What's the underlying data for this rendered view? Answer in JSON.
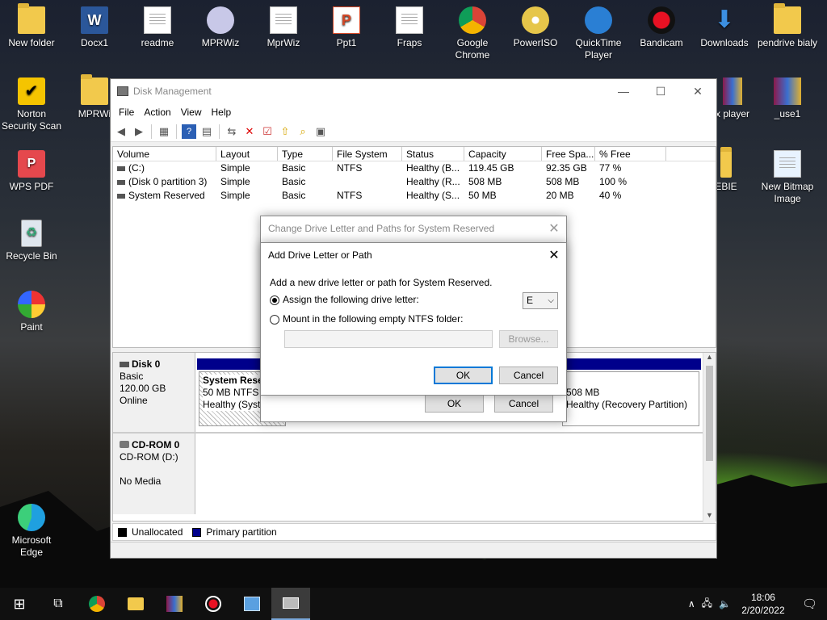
{
  "desktop": {
    "icons": [
      {
        "label": "New folder"
      },
      {
        "label": "Docx1"
      },
      {
        "label": "readme"
      },
      {
        "label": "MPRWiz"
      },
      {
        "label": "MprWiz"
      },
      {
        "label": "Ppt1"
      },
      {
        "label": "Fraps"
      },
      {
        "label": "Google Chrome"
      },
      {
        "label": "PowerISO"
      },
      {
        "label": "QuickTime Player"
      },
      {
        "label": "Bandicam"
      },
      {
        "label": "Downloads"
      },
      {
        "label": "pendrive bialy"
      },
      {
        "label": "Norton Security Scan"
      },
      {
        "label": "MPRWi"
      },
      {
        "label": "x player"
      },
      {
        "label": "_use1"
      },
      {
        "label": "WPS PDF"
      },
      {
        "label": "EBIE"
      },
      {
        "label": "New Bitmap Image"
      },
      {
        "label": "Recycle Bin"
      },
      {
        "label": "Paint"
      },
      {
        "label": "Microsoft Edge"
      }
    ]
  },
  "window": {
    "title": "Disk Management",
    "menu": [
      "File",
      "Action",
      "View",
      "Help"
    ],
    "volume_table": {
      "headers": [
        "Volume",
        "Layout",
        "Type",
        "File System",
        "Status",
        "Capacity",
        "Free Spa...",
        "% Free"
      ],
      "rows": [
        [
          "(C:)",
          "Simple",
          "Basic",
          "NTFS",
          "Healthy (B...",
          "119.45 GB",
          "92.35 GB",
          "77 %"
        ],
        [
          "(Disk 0 partition 3)",
          "Simple",
          "Basic",
          "",
          "Healthy (R...",
          "508 MB",
          "508 MB",
          "100 %"
        ],
        [
          "System Reserved",
          "Simple",
          "Basic",
          "NTFS",
          "Healthy (S...",
          "50 MB",
          "20 MB",
          "40 %"
        ]
      ]
    },
    "disks": [
      {
        "name": "Disk 0",
        "type": "Basic",
        "size": "120.00 GB",
        "state": "Online"
      },
      {
        "name": "CD-ROM 0",
        "type": "CD-ROM (D:)",
        "state": "No Media"
      }
    ],
    "partitions": {
      "system_reserved": {
        "name": "System Rese",
        "size": "50 MB NTFS",
        "status": "Healthy (Syste"
      },
      "recovery": {
        "size": "508 MB",
        "status": "Healthy (Recovery Partition)"
      }
    },
    "legend": {
      "unallocated": "Unallocated",
      "primary": "Primary partition"
    }
  },
  "change_dialog": {
    "title": "Change Drive Letter and Paths for System Reserved",
    "ok": "OK",
    "cancel": "Cancel"
  },
  "add_dialog": {
    "title": "Add Drive Letter or Path",
    "description": "Add a new drive letter or path for System Reserved.",
    "assign_label": "Assign the following drive letter:",
    "selected_letter": "E",
    "mount_label": "Mount in the following empty NTFS folder:",
    "folder_value": "",
    "browse": "Browse...",
    "ok": "OK",
    "cancel": "Cancel"
  },
  "taskbar": {
    "time": "18:06",
    "date": "2/20/2022"
  },
  "colors": {
    "primary_partition": "#00008b",
    "unallocated": "#000000",
    "accent": "#0078d7"
  }
}
